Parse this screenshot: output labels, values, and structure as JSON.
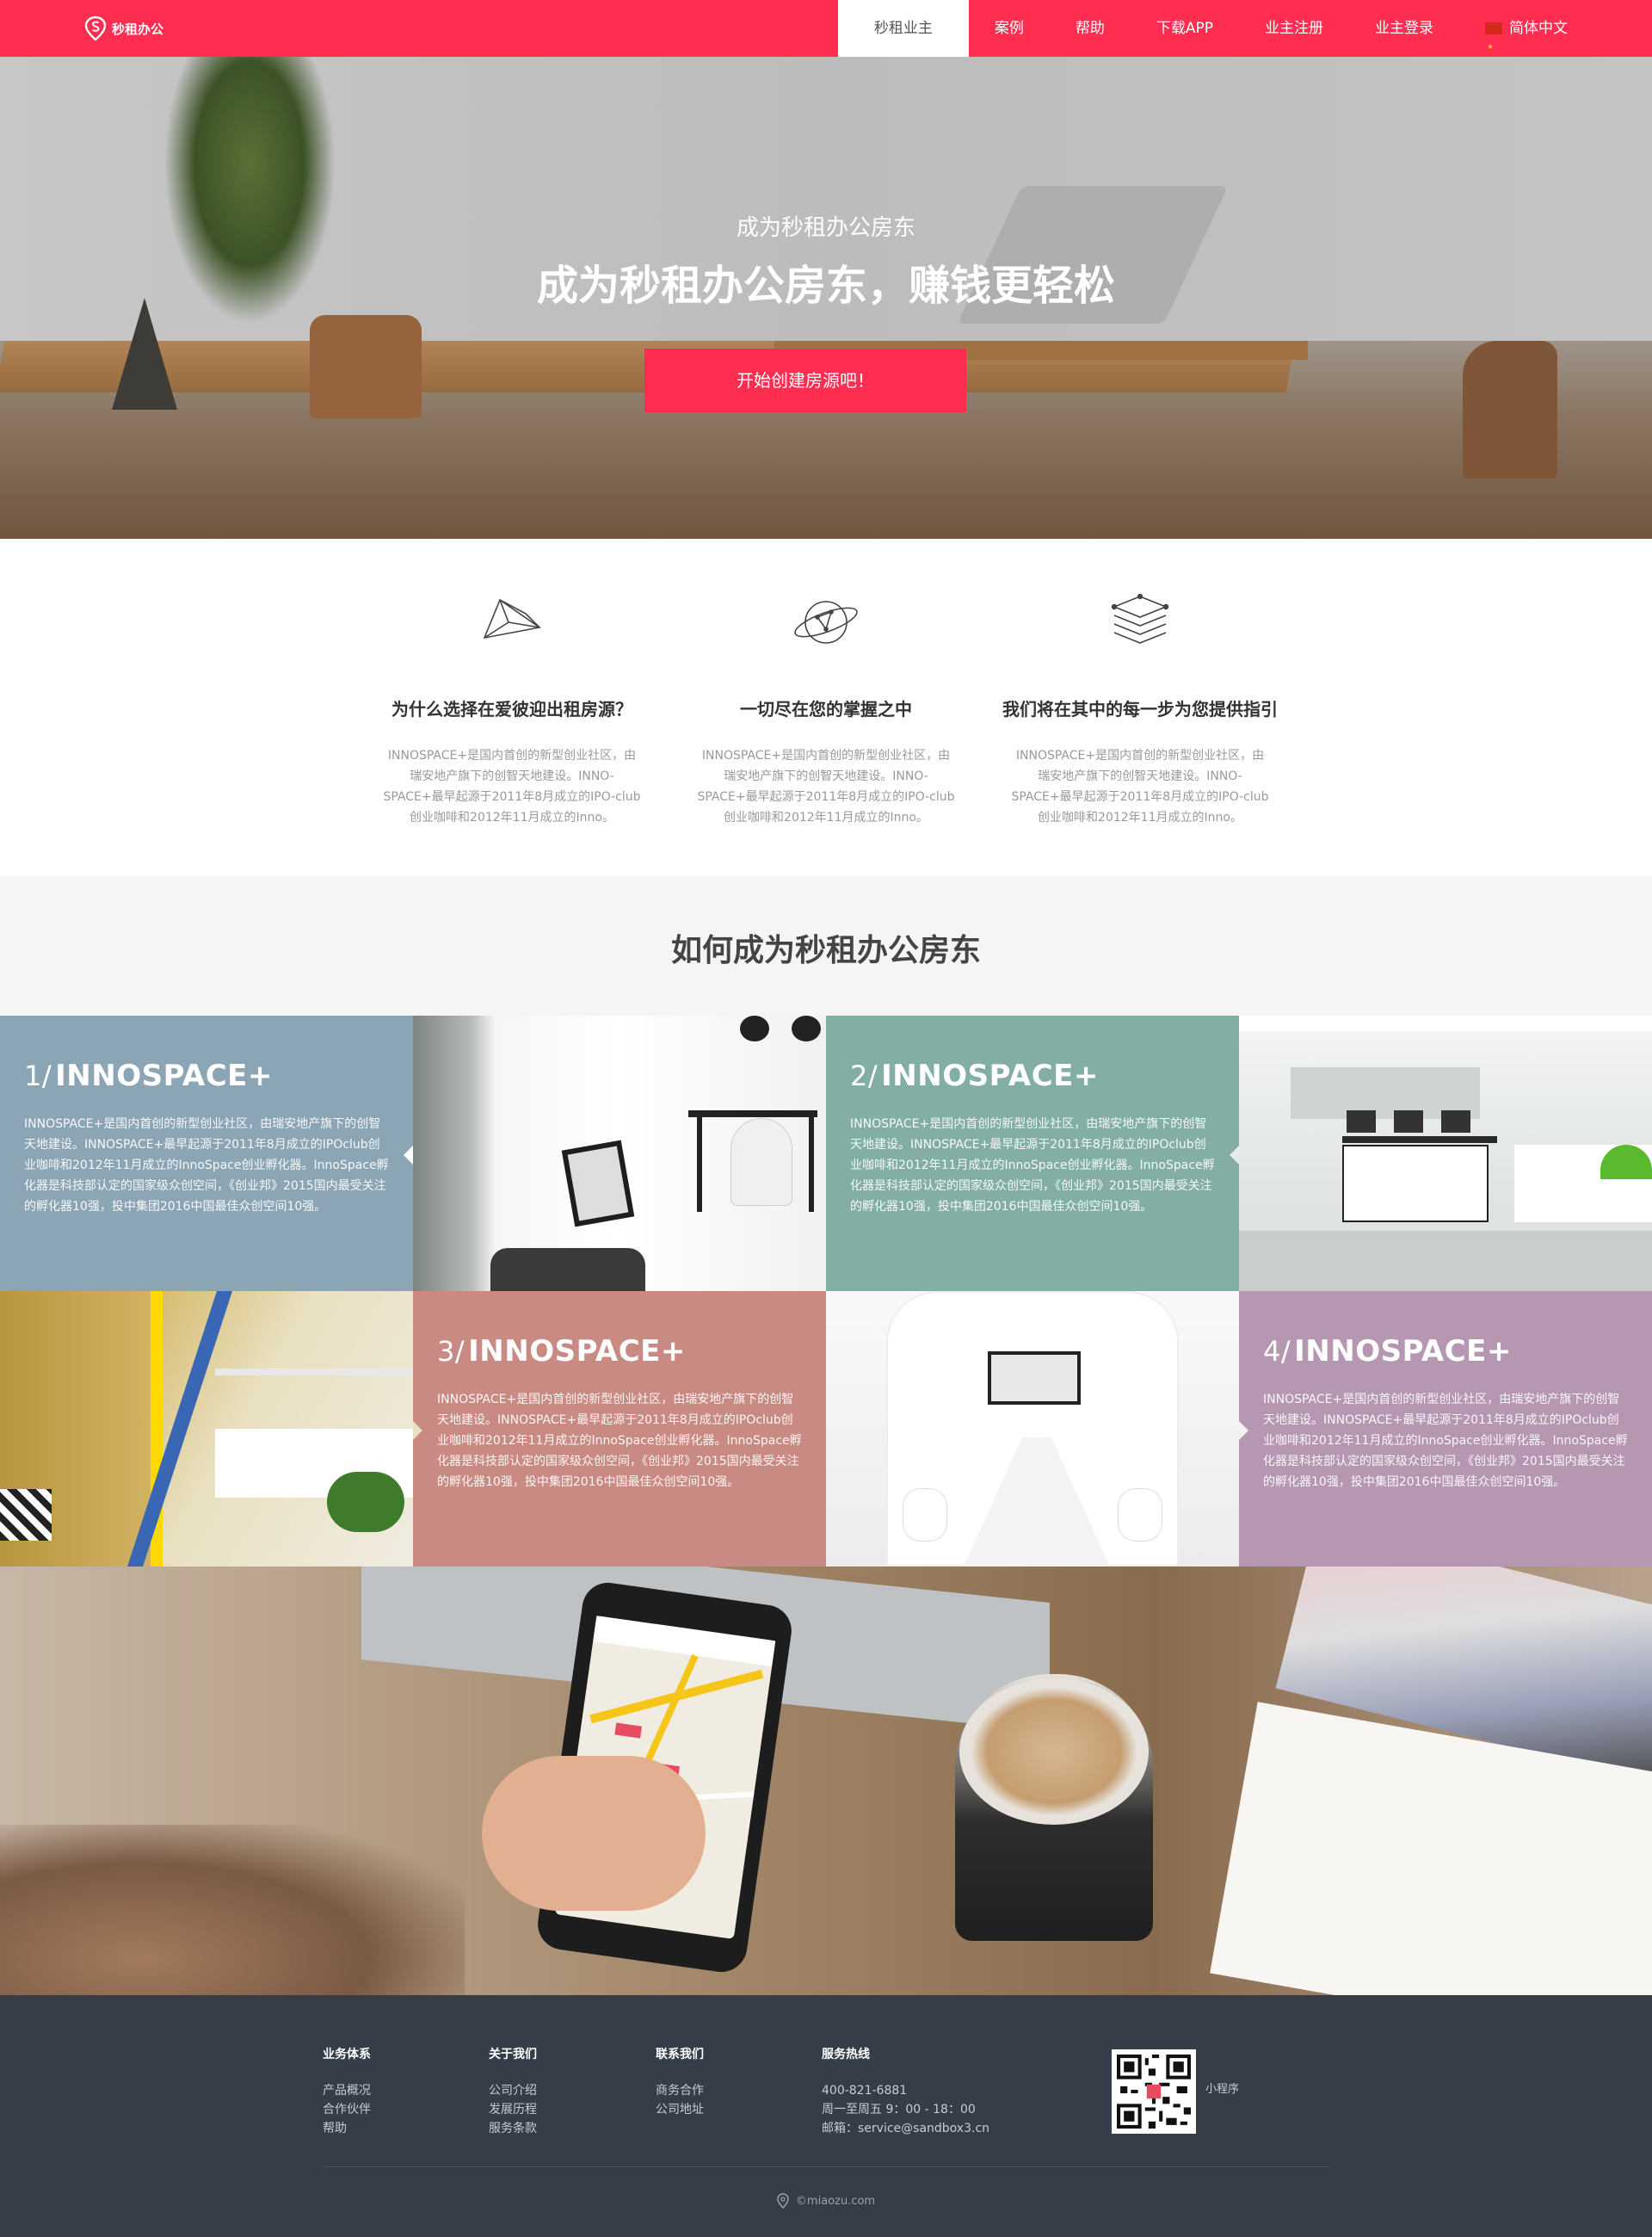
{
  "brand": {
    "name": "秒租办公"
  },
  "nav": {
    "items": [
      {
        "label": "秒租业主",
        "active": true
      },
      {
        "label": "案例"
      },
      {
        "label": "帮助"
      },
      {
        "label": "下载APP"
      },
      {
        "label": "业主注册"
      },
      {
        "label": "业主登录"
      }
    ],
    "language": "简体中文"
  },
  "hero": {
    "subtitle": "成为秒租办公房东",
    "title": "成为秒租办公房东，赚钱更轻松",
    "cta": "开始创建房源吧！"
  },
  "features": [
    {
      "icon": "network-triangle-icon",
      "title": "为什么选择在爱彼迎出租房源？",
      "text": "INNOSPACE+是国内首创的新型创业社区，由瑞安地产旗下的创智天地建设。INNO-SPACE+最早起源于2011年8月成立的IPO-club创业咖啡和2012年11月成立的Inno。"
    },
    {
      "icon": "planet-orbit-icon",
      "title": "一切尽在您的掌握之中",
      "text": "INNOSPACE+是国内首创的新型创业社区，由瑞安地产旗下的创智天地建设。INNO-SPACE+最早起源于2011年8月成立的IPO-club创业咖啡和2012年11月成立的Inno。"
    },
    {
      "icon": "layers-stack-icon",
      "title": "我们将在其中的每一步为您提供指引",
      "text": "INNOSPACE+是国内首创的新型创业社区，由瑞安地产旗下的创智天地建设。INNO-SPACE+最早起源于2011年8月成立的IPO-club创业咖啡和2012年11月成立的Inno。"
    }
  ],
  "howto": {
    "title": "如何成为秒租办公房东",
    "steps": [
      {
        "num": "1/",
        "title": "INNOSPACE+",
        "color": "#8ca5b5",
        "text": "INNOSPACE+是国内首创的新型创业社区，由瑞安地产旗下的创智天地建设。INNOSPACE+最早起源于2011年8月成立的IPOclub创业咖啡和2012年11月成立的InnoSpace创业孵化器。InnoSpace孵化器是科技部认定的国家级众创空间，《创业邦》2015国内最受关注的孵化器10强，投中集团2016中国最佳众创空间10强。"
      },
      {
        "num": "2/",
        "title": "INNOSPACE+",
        "color": "#83aea6",
        "text": "INNOSPACE+是国内首创的新型创业社区，由瑞安地产旗下的创智天地建设。INNOSPACE+最早起源于2011年8月成立的IPOclub创业咖啡和2012年11月成立的InnoSpace创业孵化器。InnoSpace孵化器是科技部认定的国家级众创空间，《创业邦》2015国内最受关注的孵化器10强，投中集团2016中国最佳众创空间10强。"
      },
      {
        "num": "3/",
        "title": "INNOSPACE+",
        "color": "#c98a83",
        "text": "INNOSPACE+是国内首创的新型创业社区，由瑞安地产旗下的创智天地建设。INNOSPACE+最早起源于2011年8月成立的IPOclub创业咖啡和2012年11月成立的InnoSpace创业孵化器。InnoSpace孵化器是科技部认定的国家级众创空间，《创业邦》2015国内最受关注的孵化器10强，投中集团2016中国最佳众创空间10强。"
      },
      {
        "num": "4/",
        "title": "INNOSPACE+",
        "color": "#b697b2",
        "text": "INNOSPACE+是国内首创的新型创业社区，由瑞安地产旗下的创智天地建设。INNOSPACE+最早起源于2011年8月成立的IPOclub创业咖啡和2012年11月成立的InnoSpace创业孵化器。InnoSpace孵化器是科技部认定的国家级众创空间，《创业邦》2015国内最受关注的孵化器10强，投中集团2016中国最佳众创空间10强。"
      }
    ]
  },
  "footer": {
    "columns": [
      {
        "title": "业务体系",
        "links": [
          "产品概况",
          "合作伙伴",
          "帮助"
        ]
      },
      {
        "title": "关于我们",
        "links": [
          "公司介绍",
          "发展历程",
          "服务条款"
        ]
      },
      {
        "title": "联系我们",
        "links": [
          "商务合作",
          "公司地址"
        ]
      }
    ],
    "hotline": {
      "title": "服务热线",
      "phone": "400-821-6881",
      "hours": "周一至周五 9：00 - 18：00",
      "email": "邮箱：service@sandbox3.cn"
    },
    "qr_label": "小程序",
    "copyright": "©miaozu.com"
  },
  "colors": {
    "accent": "#ff2d4f",
    "footer_bg": "#343d48",
    "section_bg": "#f5f5f5"
  }
}
